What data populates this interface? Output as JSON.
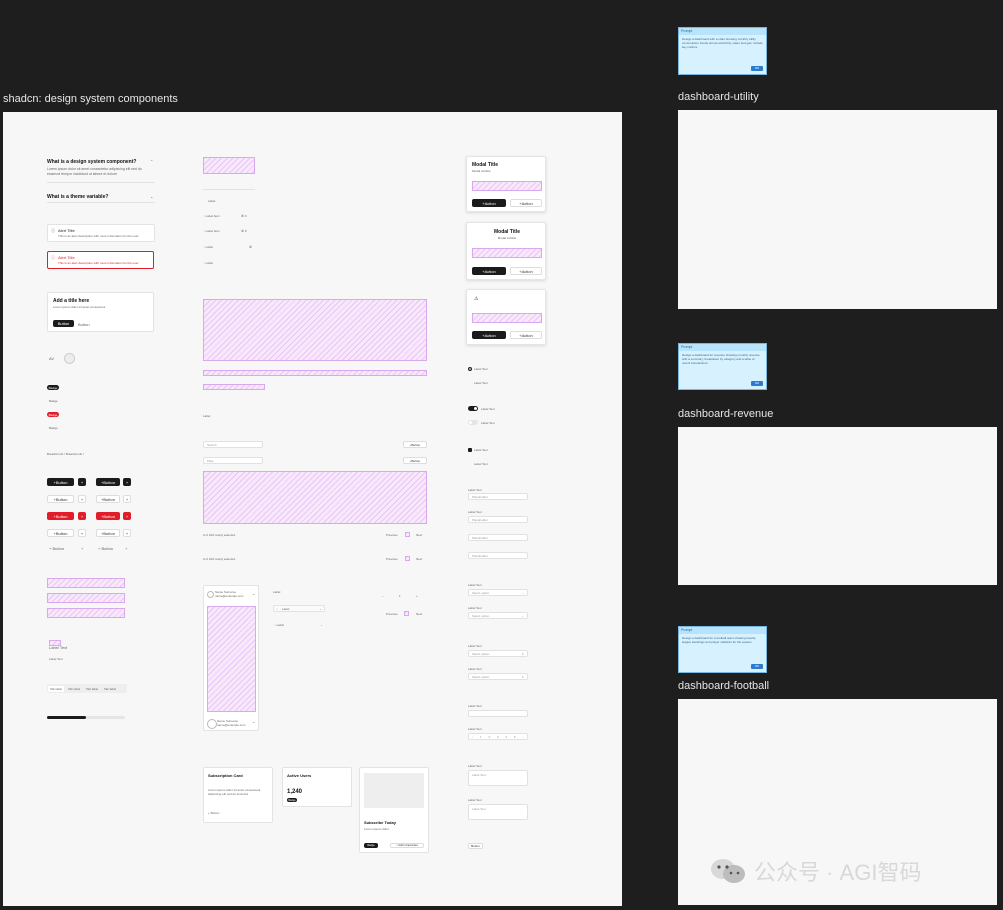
{
  "main_frame": {
    "title": "shadcn: design system components",
    "accordion": [
      {
        "q": "What is a design system component?",
        "a": "Lorem ipsum dolor sit amet consectetur adipiscing elit sed do eiusmod tempor incididunt ut labore et dolore"
      },
      {
        "q": "What is a theme variable?"
      }
    ],
    "alerts": [
      {
        "title": "Alert Title",
        "desc": "This is an alert description with more information for the user.",
        "variant": "default"
      },
      {
        "title": "Alert Title",
        "desc": "This is an alert description with more information for the user.",
        "variant": "destructive"
      }
    ],
    "card_small": {
      "title": "Add a title here",
      "desc": "Lorem ipsum dolor sit amet consectetur",
      "primary": "Button",
      "secondary": "Button"
    },
    "badges": [
      "Badge",
      "Badge",
      "Badge",
      "Badge"
    ],
    "breadcrumb": "Breadcrumb   /   Breadcrumb   /   ",
    "button_label": "Button",
    "labels": {
      "form_label": "Label Text",
      "label_small": "Label Text"
    },
    "tabs": [
      "Tab label",
      "Tab label",
      "Tab label",
      "Tab label"
    ],
    "middle": {
      "menu_items": [
        "Label",
        "Label Item",
        "Label Item",
        "Label",
        "Label"
      ],
      "menu_shortcuts": [
        "⌘ K",
        "⌘ K",
        "⌘"
      ],
      "caption": "Label",
      "search_placeholder": "Search",
      "filter_placeholder": "Filter",
      "button_label": "Button",
      "pagination_text": "0 of 100 row(s) selected.",
      "pagination_prev": "Previous",
      "pagination_next": "Next",
      "profile_name": "Name Surname",
      "profile_email": "name@example.com",
      "label": "Label",
      "stepper_value": "1"
    },
    "cards_bottom": [
      {
        "title": "Subscription Card",
        "desc": "Lorem ipsum dolor sit amet consectetur adipiscing elit sed do eiusmod",
        "action": "Button"
      },
      {
        "title": "Active Users",
        "value": "1,240",
        "badge": "Badge"
      },
      {
        "title": "Subscribe Today",
        "desc": "Lorem ipsum dolor",
        "badge": "Badge",
        "action": "Add to Favourites"
      }
    ],
    "modals": [
      {
        "title": "Modal Title",
        "desc": "Modal subtitle",
        "primary": "Action",
        "secondary": "Action"
      },
      {
        "title": "Modal Title",
        "desc": "Modal subtitle",
        "primary": "Action",
        "secondary": "Action"
      },
      {
        "primary": "Action",
        "secondary": "Action"
      }
    ],
    "right_controls": {
      "radio_label": "Label Text",
      "radio_sub": "Label Text",
      "switch_on": "Label Text",
      "switch_off": "Label Text",
      "checkbox_label": "Label Text",
      "checkbox_sub": "Label Text",
      "field_labels": [
        "Label Text",
        "Label Text",
        "Label Text",
        "Label Text",
        "Label Text",
        "Label Text",
        "Label Text",
        "Label Text",
        "Label Text",
        "Label Text",
        "Label Text"
      ],
      "field_placeholders": [
        "Placeholder",
        "Placeholder",
        "Placeholder",
        "Placeholder",
        "Select option",
        "Select option",
        "Select option",
        "Select option"
      ],
      "submit": "Button"
    }
  },
  "side_frames": [
    {
      "name": "dashboard-utility",
      "prompt_header": "Prompt",
      "prompt_text": "Design a dashboard with a chart showing monthly utility consumption trends across electricity, water and gas. Include key metrics."
    },
    {
      "name": "dashboard-revenue",
      "prompt_header": "Prompt",
      "prompt_text": "Design a dashboard for revenue showing monthly revenue with a summary, breakdown by category and a table of recent transactions."
    },
    {
      "name": "dashboard-football",
      "prompt_header": "Prompt",
      "prompt_text": "Design a dashboard for a football team showing results, league standings and player statistics for the season."
    }
  ],
  "prompt_ok": "OK",
  "watermark": "公众号 · AGI智码",
  "colors": {
    "canvas": "#1e1e1e",
    "frame": "#f7f7f7",
    "accent_dark": "#1b1b1b",
    "destructive": "#e11d2a",
    "placeholder_hatch": "#e9c6f5",
    "prompt_bg": "#d7f1ff"
  }
}
